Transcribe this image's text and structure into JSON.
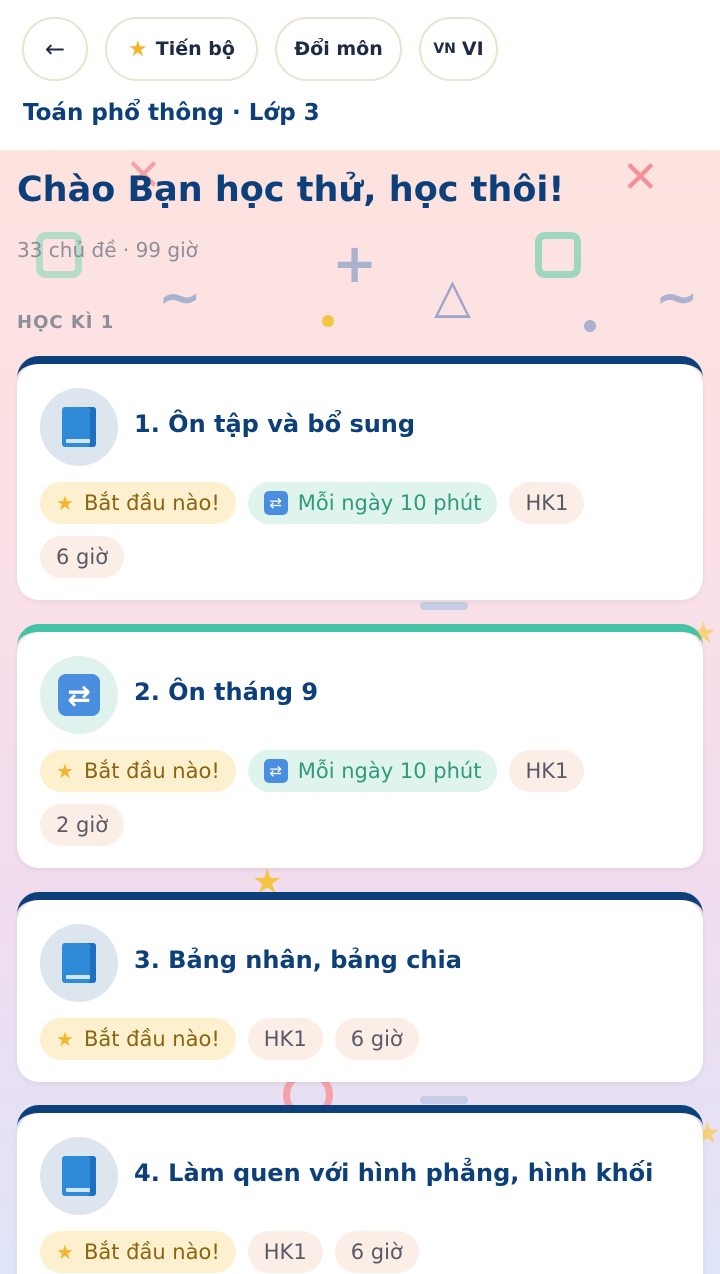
{
  "header": {
    "back_label": "←",
    "progress_label": "Tiến bộ",
    "change_subject_label": "Đổi môn",
    "lang_flag": "VN",
    "lang_label": "VI",
    "subject_line": "Toán phổ thông · Lớp 3"
  },
  "hero": {
    "greeting": "Chào Bạn học thử, học thôi!",
    "meta": "33 chủ đề · 99 giờ",
    "section_label": "HỌC KÌ 1"
  },
  "cards": [
    {
      "title": "1. Ôn tập và bổ sung",
      "icon": "book-icon",
      "start": "Bắt đầu nào!",
      "daily": "Mỗi ngày 10 phút",
      "term": "HK1",
      "hours": "6 giờ"
    },
    {
      "title": "2. Ôn tháng 9",
      "icon": "repeat-icon",
      "start": "Bắt đầu nào!",
      "daily": "Mỗi ngày 10 phút",
      "term": "HK1",
      "hours": "2 giờ"
    },
    {
      "title": "3. Bảng nhân, bảng chia",
      "icon": "book-icon",
      "start": "Bắt đầu nào!",
      "term": "HK1",
      "hours": "6 giờ"
    },
    {
      "title": "4. Làm quen với hình phẳng, hình khối",
      "icon": "book-icon",
      "start": "Bắt đầu nào!",
      "term": "HK1",
      "hours": "6 giờ"
    }
  ],
  "colors": {
    "brand_navy": "#0d3f7a",
    "review_accent": "#43c3a3",
    "star": "#f2b632"
  }
}
